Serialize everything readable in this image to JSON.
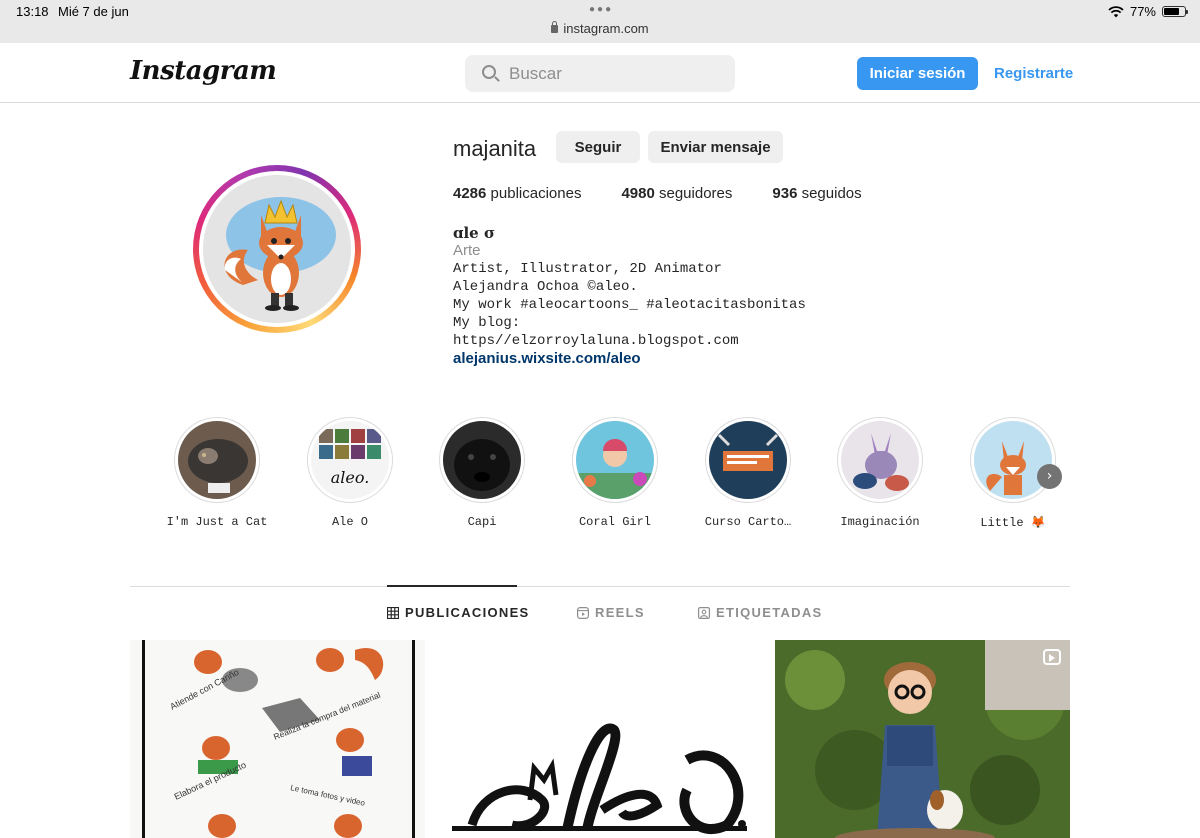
{
  "status_bar": {
    "time": "13:18",
    "date": "Mié 7 de jun",
    "url": "instagram.com",
    "battery": "77%",
    "battery_level": 0.77
  },
  "nav": {
    "logo": "Instagram",
    "search_placeholder": "Buscar",
    "login_label": "Iniciar sesión",
    "signup_label": "Registrarte"
  },
  "profile": {
    "username": "majanita",
    "follow_label": "Seguir",
    "message_label": "Enviar mensaje",
    "stats": {
      "posts_count": "4286",
      "posts_label": "publicaciones",
      "followers_count": "4980",
      "followers_label": "seguidores",
      "following_count": "936",
      "following_label": "seguidos"
    },
    "bio": {
      "name": "ɑle σ",
      "category": "Arte",
      "lines": [
        "Artist, Illustrator, 2D Animator",
        "Alejandra Ochoa ©aleo.",
        "My work #aleocartoons_ #aleotacitasbonitas",
        "My blog:",
        "https//elzorroylaluna.blogspot.com"
      ],
      "link": "alejanius.wixsite.com/aleo"
    }
  },
  "highlights": [
    {
      "label": "I'm Just a Cat"
    },
    {
      "label": "Ale O"
    },
    {
      "label": "Capi"
    },
    {
      "label": "Coral Girl"
    },
    {
      "label": "Curso Carto…"
    },
    {
      "label": "Imaginación"
    },
    {
      "label": "Little 🦊"
    }
  ],
  "tabs": [
    {
      "label": "PUBLICACIONES",
      "icon": "grid-icon"
    },
    {
      "label": "REELS",
      "icon": "reels-icon"
    },
    {
      "label": "ETIQUETADAS",
      "icon": "tagged-icon"
    }
  ],
  "post_texts": {
    "post1_captions": [
      "Atiende con Cariño",
      "Realiza la compra del material",
      "Elabora el producto",
      "Le toma fotos y video"
    ]
  },
  "colors": {
    "accent": "#3897f0",
    "link": "#00376b"
  }
}
